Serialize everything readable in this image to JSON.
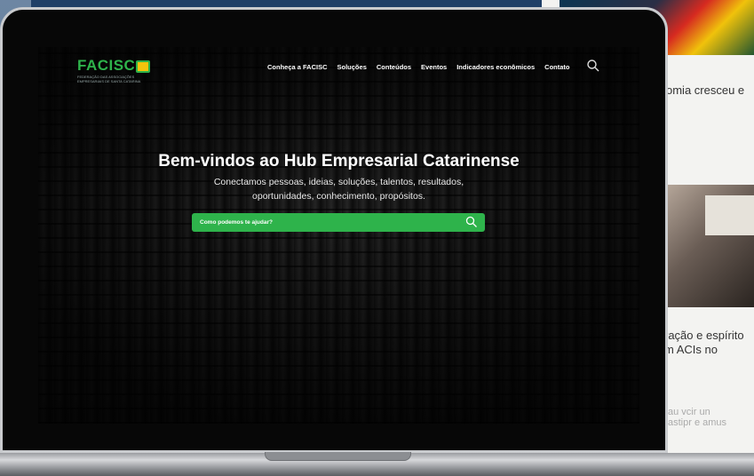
{
  "site": {
    "logo_text": "FACISC",
    "logo_subtitle": "FEDERAÇÃO DAS ASSOCIAÇÕES EMPRESARIAIS DE SANTA CATARINA",
    "brand_color": "#2eb34b",
    "flag_color": "#f2c40d"
  },
  "nav": {
    "items": [
      {
        "label": "Conheça a FACISC"
      },
      {
        "label": "Soluções"
      },
      {
        "label": "Conteúdos"
      },
      {
        "label": "Eventos"
      },
      {
        "label": "Indicadores econômicos"
      },
      {
        "label": "Contato"
      }
    ],
    "search_icon": "search-icon"
  },
  "hero": {
    "title": "Bem-vindos ao Hub Empresarial Catarinense",
    "subtitle_line1": "Conectamos pessoas, ideias, soluções, talentos, resultados,",
    "subtitle_line2": "oportunidades, conhecimento, propósitos."
  },
  "search": {
    "placeholder": "Como podemos te ajudar?",
    "value": "",
    "icon": "search-icon"
  },
  "background_page": {
    "news_text_1": "omia cresceu e",
    "news_text_2_line1": "ração e espírito",
    "news_text_2_line2": "m ACIs no",
    "news_text_3_line1": "au vcir un",
    "news_text_3_line2": "astipr e amus",
    "quote_mark": "”"
  }
}
